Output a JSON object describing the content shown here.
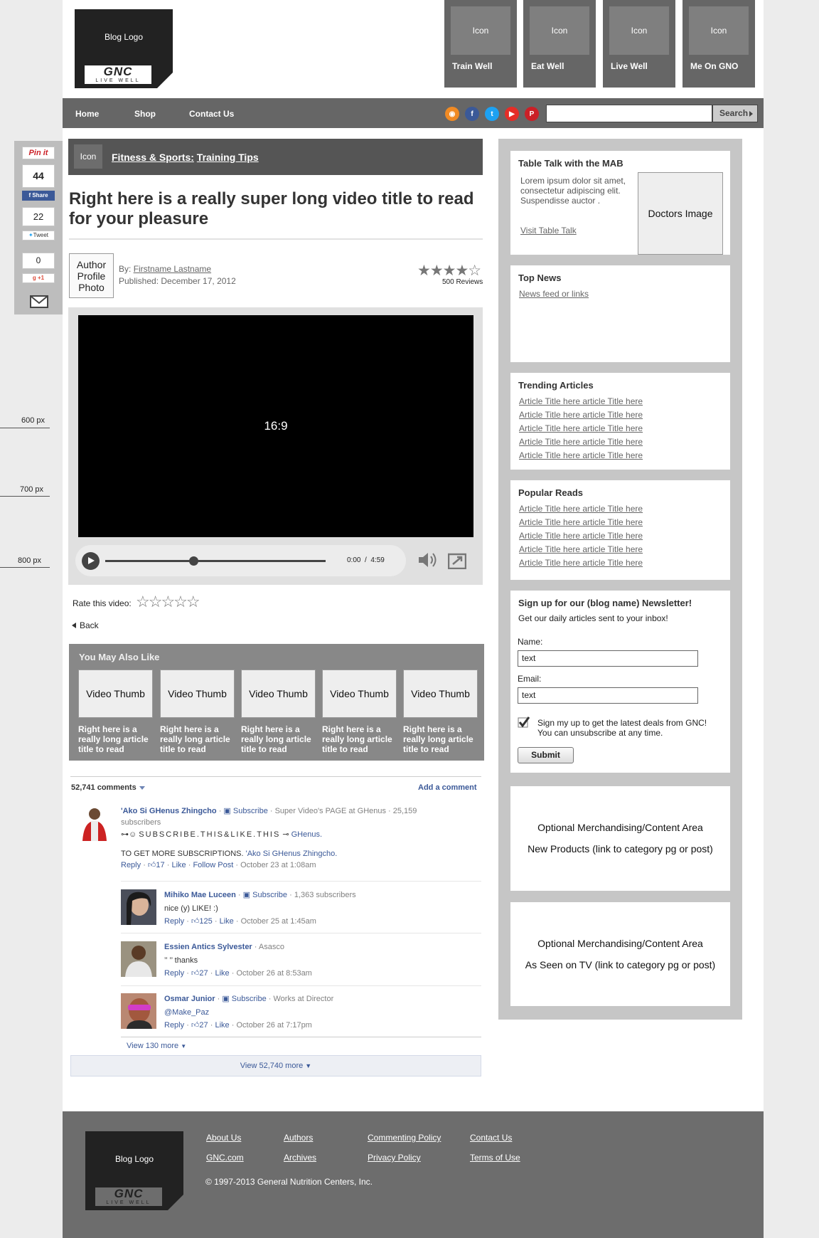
{
  "header": {
    "logo_text": "Blog Logo",
    "brand": "GNC",
    "brand_tag": "LIVE WELL",
    "nav_boxes": [
      {
        "icon": "Icon",
        "label": "Train Well"
      },
      {
        "icon": "Icon",
        "label": "Eat Well"
      },
      {
        "icon": "Icon",
        "label": "Live Well"
      },
      {
        "icon": "Icon",
        "label": "Me On GNO"
      }
    ]
  },
  "topnav": {
    "links": [
      "Home",
      "Shop",
      "Contact Us"
    ],
    "search_placeholder": "",
    "search_label": "Search"
  },
  "share": {
    "pinterest_label": "Pin it",
    "fb_count": "44",
    "fb_label": "Share",
    "tw_count": "22",
    "tw_label": "Tweet",
    "gplus_count": "0",
    "gplus_label": "+1"
  },
  "article": {
    "crumb_icon": "Icon",
    "crumb_category": "Fitness & Sports:",
    "crumb_sub": "Training Tips",
    "title": "Right here is a really super long video title to read for your pleasure",
    "author_photo": "Author Profile Photo",
    "by_prefix": "By:",
    "author": "Firstname Lastname",
    "published": "Published: December 17, 2012",
    "rating": 4,
    "rating_max": 5,
    "reviews": "500 Reviews"
  },
  "video": {
    "aspect_label": "16:9",
    "time_current": "0:00",
    "time_sep": "/",
    "time_total": "4:59",
    "progress": 0.4
  },
  "rate": {
    "label": "Rate this video:",
    "stars": "☆☆☆☆☆",
    "back": "Back"
  },
  "ymal": {
    "title": "You May Also Like",
    "items": [
      {
        "thumb": "Video Thumb",
        "title": "Right here is a really long article title to read"
      },
      {
        "thumb": "Video Thumb",
        "title": "Right here is a really long article title to read"
      },
      {
        "thumb": "Video Thumb",
        "title": "Right here is a really long article title to read"
      },
      {
        "thumb": "Video Thumb",
        "title": "Right here is a really long article title to read"
      },
      {
        "thumb": "Video Thumb",
        "title": "Right here is a really long article title to read"
      }
    ]
  },
  "comments": {
    "count": "52,741 comments",
    "add": "Add a comment",
    "main": {
      "name": "'Ako Si GHenus Zhingcho",
      "subscribe": "Subscribe",
      "meta": "· Super Video's PAGE at GHenus · 25,159 subscribers",
      "line1": "SUBSCRIBE.THIS&LIKE.THIS",
      "line1_link": "GHenus.",
      "line2": "TO GET MORE SUBSCRIPTIONS.",
      "line2_link": "'Ako Si GHenus Zhingcho.",
      "reply": "Reply",
      "likes": "17",
      "like": "Like",
      "follow": "Follow Post",
      "date": "October 23 at 1:08am"
    },
    "replies": [
      {
        "name": "Mihiko Mae Luceen",
        "subscribe": "Subscribe",
        "meta": "· 1,363 subscribers",
        "text": "nice (y) LIKE! :)",
        "reply": "Reply",
        "likes": "125",
        "like": "Like",
        "date": "October 25 at 1:45am"
      },
      {
        "name": "Essien Antics Sylvester",
        "subscribe": "",
        "meta": "· Asasco",
        "text": "’’ ’’ thanks",
        "reply": "Reply",
        "likes": "27",
        "like": "Like",
        "date": "October 26 at 8:53am"
      },
      {
        "name": "Osmar Junior",
        "subscribe": "Subscribe",
        "meta": "· Works at Director",
        "text": "@Make_Paz",
        "reply": "Reply",
        "likes": "27",
        "like": "Like",
        "date": "October 26 at 7:17pm"
      }
    ],
    "view_130": "View 130 more",
    "view_all": "View 52,740 more"
  },
  "sidebar": {
    "table_talk": {
      "title": "Table Talk with the MAB",
      "body": "Lorem ipsum dolor sit amet, consectetur adipiscing elit. Suspendisse auctor .",
      "link": "Visit Table Talk",
      "image": "Doctors Image"
    },
    "top_news": {
      "title": "Top News",
      "link": "News feed or links"
    },
    "trending": {
      "title": "Trending Articles",
      "items": [
        "Article Title here article Title here",
        "Article Title here article Title here",
        "Article Title here article Title here",
        "Article Title here article Title here",
        "Article Title here article Title here"
      ]
    },
    "popular": {
      "title": "Popular Reads",
      "items": [
        "Article Title here article Title here",
        "Article Title here article Title here",
        "Article Title here article Title here",
        "Article Title here article Title here",
        "Article Title here article Title here"
      ]
    },
    "newsletter": {
      "title": "Sign up for our (blog name) Newsletter!",
      "subtitle": "Get our daily articles sent to your inbox!",
      "name_label": "Name:",
      "name_value": "text",
      "email_label": "Email:",
      "email_value": "text",
      "checkbox_text": "Sign my up to get the latest deals from GNC! You can unsubscribe at any time.",
      "checked": true,
      "submit": "Submit"
    },
    "merch1": {
      "title": "Optional Merchandising/Content Area",
      "sub": "New Products (link to category pg or post)"
    },
    "merch2": {
      "title": "Optional Merchandising/Content Area",
      "sub": "As Seen on TV (link to category pg or post)"
    }
  },
  "markers": [
    "600 px",
    "700 px",
    "800 px"
  ],
  "footer": {
    "logo_text": "Blog Logo",
    "brand": "GNC",
    "brand_tag": "LIVE WELL",
    "links": [
      "About Us",
      "Authors",
      "Commenting Policy",
      "Contact Us",
      "GNC.com",
      "Archives",
      "Privacy Policy",
      "Terms of Use"
    ],
    "copyright": "© 1997-2013 General Nutrition Centers, Inc."
  },
  "colors": {
    "rss": "#f08a24",
    "facebook": "#3b5998",
    "twitter": "#1da1f2",
    "youtube": "#e52d27",
    "pinterest": "#cb2027",
    "comment_link": "#3b5998"
  }
}
